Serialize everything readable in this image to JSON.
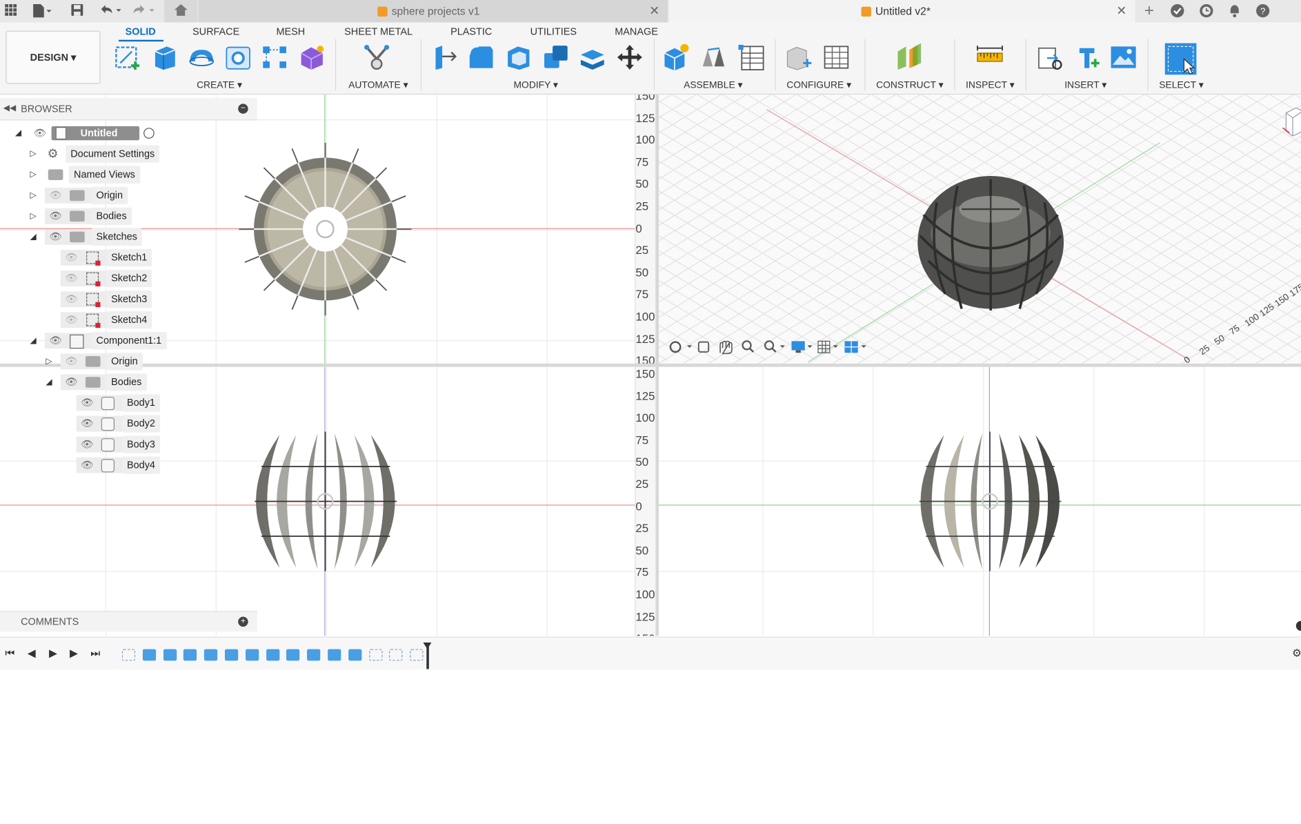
{
  "titlebar": {
    "tabs": [
      {
        "label": "sphere projects v1",
        "active": false
      },
      {
        "label": "Untitled v2*",
        "active": true
      }
    ],
    "icons": [
      "apps-grid-icon",
      "file-icon",
      "save-icon",
      "undo-icon",
      "redo-icon",
      "home-icon",
      "new-tab-icon",
      "job-status-icon",
      "clock-icon",
      "notifications-icon",
      "help-icon"
    ]
  },
  "toolbar": {
    "workspace": "DESIGN",
    "tabs": [
      "SOLID",
      "SURFACE",
      "MESH",
      "SHEET METAL",
      "PLASTIC",
      "UTILITIES",
      "MANAGE"
    ],
    "groups": [
      "CREATE",
      "AUTOMATE",
      "MODIFY",
      "ASSEMBLE",
      "CONFIGURE",
      "CONSTRUCT",
      "INSPECT",
      "INSERT",
      "SELECT"
    ]
  },
  "browser": {
    "title": "BROWSER",
    "root": "Untitled v2",
    "items": [
      {
        "label": "Document Settings"
      },
      {
        "label": "Named Views"
      },
      {
        "label": "Origin"
      },
      {
        "label": "Bodies"
      },
      {
        "label": "Sketches"
      },
      {
        "label": "Sketch1"
      },
      {
        "label": "Sketch2"
      },
      {
        "label": "Sketch3"
      },
      {
        "label": "Sketch4"
      },
      {
        "label": "Component1:1"
      },
      {
        "label": "Origin"
      },
      {
        "label": "Bodies"
      },
      {
        "label": "Body1"
      },
      {
        "label": "Body2"
      },
      {
        "label": "Body3"
      },
      {
        "label": "Body4"
      }
    ]
  },
  "comments": {
    "title": "COMMENTS"
  },
  "ruler_top": [
    "150",
    "125",
    "100",
    "75",
    "50",
    "25",
    "0",
    "25",
    "50",
    "75",
    "100",
    "125",
    "150"
  ],
  "ruler_bottom": [
    "150",
    "125",
    "100",
    "75",
    "50",
    "25",
    "0",
    "25",
    "50",
    "75",
    "100",
    "125",
    "150"
  ],
  "iso_ruler": [
    "175",
    "150",
    "125",
    "100",
    "75",
    "50",
    "25",
    "0"
  ],
  "colors": {
    "accent": "#0a6fc2",
    "x_axis": "#e05050",
    "y_axis": "#4aa84a",
    "z_axis": "#6a5ad8",
    "body": "#6b6b66"
  }
}
